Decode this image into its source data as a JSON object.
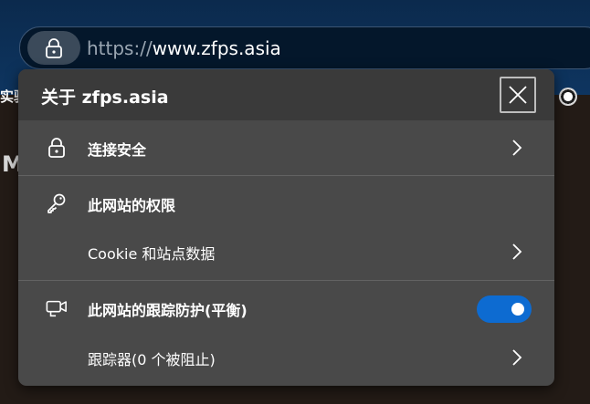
{
  "address_bar": {
    "scheme": "https://",
    "domain": "www.zfps.asia"
  },
  "bookmarks": {
    "left_partial": "实验"
  },
  "background": {
    "partial_letter": "M"
  },
  "site_info": {
    "title": "关于 zfps.asia",
    "connection": {
      "label": "连接安全",
      "icon": "lock-icon"
    },
    "permissions": {
      "label": "此网站的权限",
      "icon": "key-icon"
    },
    "cookies": {
      "label": "Cookie 和站点数据"
    },
    "tracking": {
      "label": "此网站的跟踪防护(平衡)",
      "icon": "tracking-camera-icon",
      "enabled": true
    },
    "trackers": {
      "label": "跟踪器(0 个被阻止)"
    }
  },
  "colors": {
    "toggle_on": "#0d6bd1",
    "popup_bg": "#494949",
    "header_bg": "#3a3a3a"
  }
}
